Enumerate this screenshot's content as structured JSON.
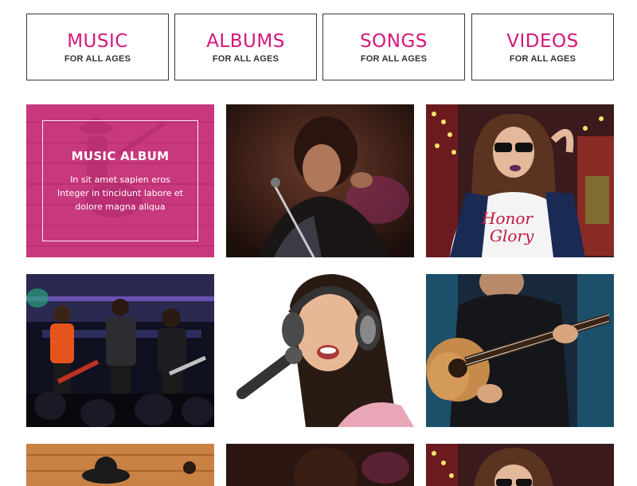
{
  "nav": [
    {
      "title": "MUSIC",
      "subtitle": "FOR ALL AGES"
    },
    {
      "title": "ALBUMS",
      "subtitle": "FOR ALL AGES"
    },
    {
      "title": "SONGS",
      "subtitle": "FOR ALL AGES"
    },
    {
      "title": "VIDEOS",
      "subtitle": "FOR ALL AGES"
    }
  ],
  "featured": {
    "title": "MUSIC ALBUM",
    "lines": [
      "In sit amet sapien eros",
      "Integer in tincidunt labore et",
      "dolore magna aliqua"
    ]
  },
  "gallery": [
    {
      "name": "guitarist-pink-overlay-photo"
    },
    {
      "name": "singer-microphone-photo"
    },
    {
      "name": "girl-sunglasses-photo"
    },
    {
      "name": "band-concert-photo"
    },
    {
      "name": "girl-headphones-singing-photo"
    },
    {
      "name": "acoustic-guitar-player-photo"
    },
    {
      "name": "guitarist-wood-photo"
    },
    {
      "name": "singer-microphone-photo-2"
    },
    {
      "name": "girl-sunglasses-photo-2"
    }
  ],
  "colors": {
    "accent": "#d5177b",
    "border": "#3a3a3a"
  }
}
